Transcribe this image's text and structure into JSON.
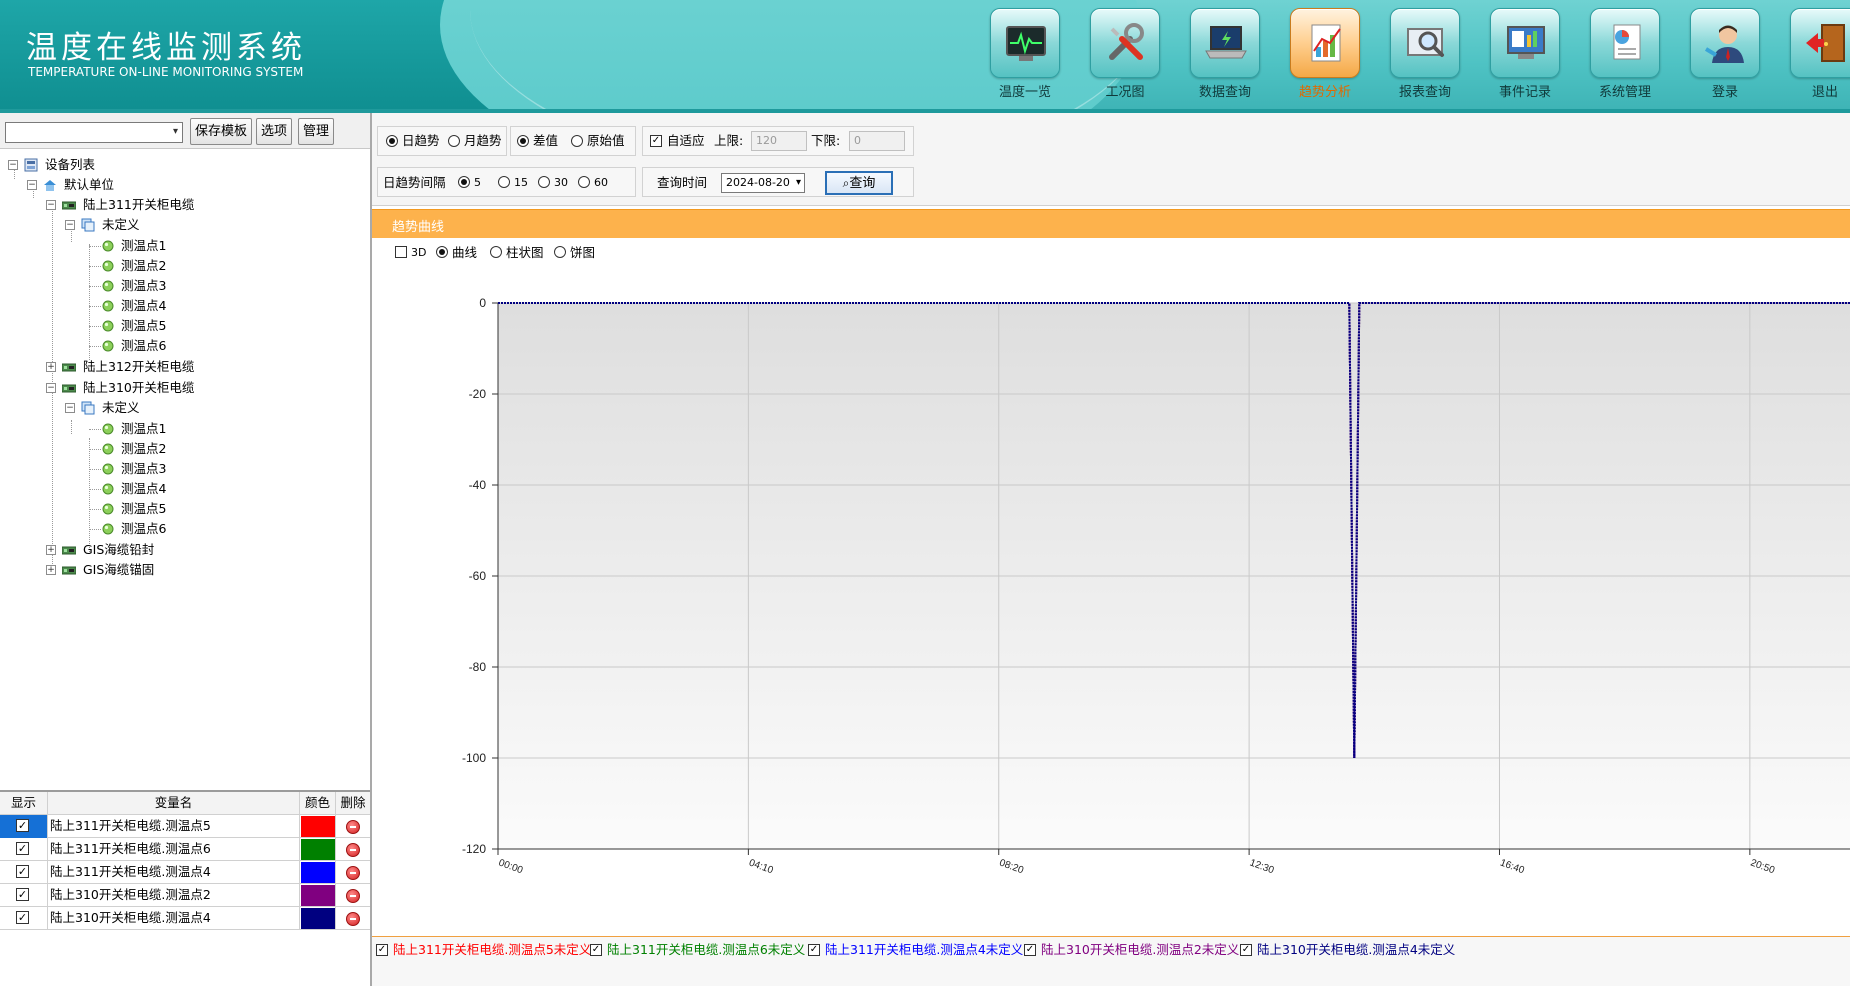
{
  "app": {
    "title": "温度在线监测系统",
    "subtitle": "TEMPERATURE ON-LINE MONITORING SYSTEM"
  },
  "nav": {
    "items": [
      {
        "label": "温度一览",
        "icon": "monitor-heartbeat-icon",
        "active": false
      },
      {
        "label": "工况图",
        "icon": "tools-icon",
        "active": false
      },
      {
        "label": "数据查询",
        "icon": "laptop-icon",
        "active": false
      },
      {
        "label": "趋势分析",
        "icon": "trend-chart-icon",
        "active": true
      },
      {
        "label": "报表查询",
        "icon": "magnifier-report-icon",
        "active": false
      },
      {
        "label": "事件记录",
        "icon": "event-screen-icon",
        "active": false
      },
      {
        "label": "系统管理",
        "icon": "document-pie-icon",
        "active": false
      },
      {
        "label": "登录",
        "icon": "user-login-icon",
        "active": false
      },
      {
        "label": "退出",
        "icon": "exit-door-icon",
        "active": false
      }
    ]
  },
  "left_toolbar": {
    "template_select": "",
    "save_template": "保存模板",
    "options": "选项",
    "manage": "管理"
  },
  "tree": {
    "root": "设备列表",
    "unit": "默认单位",
    "cable1": "陆上311开关柜电缆",
    "undefined1": "未定义",
    "cable1_points": [
      "测温点1",
      "测温点2",
      "测温点3",
      "测温点4",
      "测温点5",
      "测温点6"
    ],
    "cable2": "陆上312开关柜电缆",
    "cable3": "陆上310开关柜电缆",
    "undefined3": "未定义",
    "cable3_points": [
      "测温点1",
      "测温点2",
      "测温点3",
      "测温点4",
      "测温点5",
      "测温点6"
    ],
    "gis1": "GIS海缆铅封",
    "gis2": "GIS海缆锚固"
  },
  "var_table": {
    "headers": {
      "show": "显示",
      "name": "变量名",
      "color": "颜色",
      "delete": "删除"
    },
    "rows": [
      {
        "checked": "✓",
        "name": "陆上311开关柜电缆.测温点5",
        "color": "#ff0000"
      },
      {
        "checked": "✓",
        "name": "陆上311开关柜电缆.测温点6",
        "color": "#008000"
      },
      {
        "checked": "✓",
        "name": "陆上311开关柜电缆.测温点4",
        "color": "#0000ff"
      },
      {
        "checked": "✓",
        "name": "陆上310开关柜电缆.测温点2",
        "color": "#800080"
      },
      {
        "checked": "✓",
        "name": "陆上310开关柜电缆.测温点4",
        "color": "#000080"
      }
    ]
  },
  "filters": {
    "daily_trend": "日趋势",
    "monthly_trend": "月趋势",
    "diff_value": "差值",
    "raw_value": "原始值",
    "adaptive": "自适应",
    "upper_label": "上限:",
    "upper_value": "120",
    "lower_label": "下限:",
    "lower_value": "0",
    "interval_label": "日趋势间隔",
    "intervals": [
      "5",
      "15",
      "30",
      "60"
    ],
    "query_time_label": "查询时间",
    "query_date": "2024-08-20",
    "query_button": "查询"
  },
  "trend": {
    "header": "趋势曲线",
    "opt_3d": "3D",
    "opt_curve": "曲线",
    "opt_bar": "柱状图",
    "opt_pie": "饼图"
  },
  "chart_data": {
    "type": "line",
    "title": "",
    "xlabel": "",
    "ylabel": "",
    "ylim": [
      -120,
      0
    ],
    "yticks": [
      0,
      -20,
      -40,
      -60,
      -80,
      -100,
      -120
    ],
    "xticks": [
      "00:00",
      "04:10",
      "08:20",
      "12:30",
      "16:40",
      "20:50"
    ],
    "x_unit": "minutes since 00:00",
    "x_visible_max": 1350,
    "grid": true,
    "series": [
      {
        "name": "陆上311开关柜电缆.测温点5",
        "color": "#ff0000",
        "points": [
          [
            0,
            0
          ],
          [
            850,
            0
          ],
          [
            855,
            -100
          ],
          [
            860,
            0
          ],
          [
            1350,
            0
          ]
        ]
      },
      {
        "name": "陆上311开关柜电缆.测温点6",
        "color": "#008000",
        "points": [
          [
            0,
            0
          ],
          [
            850,
            0
          ],
          [
            855,
            -100
          ],
          [
            860,
            0
          ],
          [
            1350,
            0
          ]
        ]
      },
      {
        "name": "陆上311开关柜电缆.测温点4",
        "color": "#0000ff",
        "points": [
          [
            0,
            0
          ],
          [
            850,
            0
          ],
          [
            855,
            -100
          ],
          [
            860,
            0
          ],
          [
            1350,
            0
          ]
        ]
      },
      {
        "name": "陆上310开关柜电缆.测温点2",
        "color": "#800080",
        "points": [
          [
            0,
            0
          ],
          [
            850,
            0
          ],
          [
            855,
            -100
          ],
          [
            860,
            0
          ],
          [
            1350,
            0
          ]
        ]
      },
      {
        "name": "陆上310开关柜电缆.测温点4",
        "color": "#000080",
        "points": [
          [
            0,
            0
          ],
          [
            850,
            0
          ],
          [
            855,
            -100
          ],
          [
            860,
            0
          ],
          [
            1350,
            0
          ]
        ]
      }
    ]
  },
  "legend": {
    "items": [
      {
        "label": "陆上311开关柜电缆.测温点5未定义",
        "color": "#ff0000"
      },
      {
        "label": "陆上311开关柜电缆.测温点6未定义",
        "color": "#008000"
      },
      {
        "label": "陆上311开关柜电缆.测温点4未定义",
        "color": "#0000ff"
      },
      {
        "label": "陆上310开关柜电缆.测温点2未定义",
        "color": "#800080"
      },
      {
        "label": "陆上310开关柜电缆.测温点4未定义",
        "color": "#000080"
      }
    ]
  }
}
